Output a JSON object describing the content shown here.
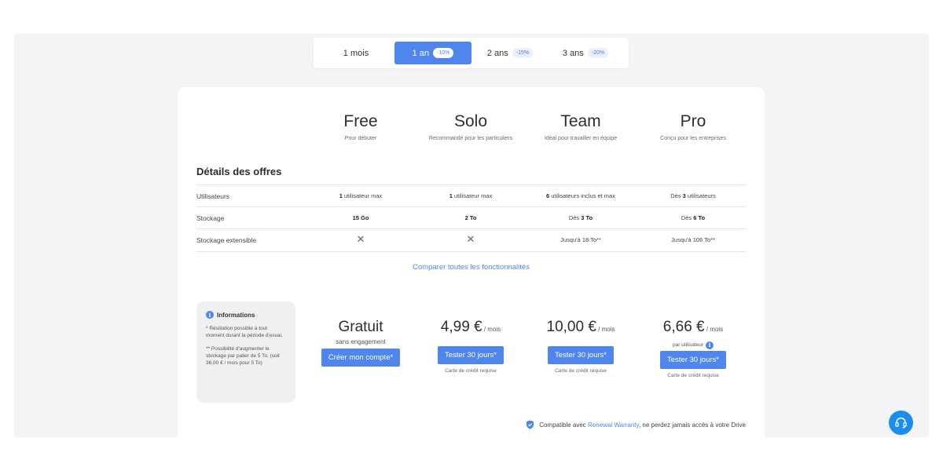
{
  "periods": [
    {
      "label": "1 mois",
      "badge": ""
    },
    {
      "label": "1 an",
      "badge": "-10%"
    },
    {
      "label": "2 ans",
      "badge": "-15%"
    },
    {
      "label": "3 ans",
      "badge": "-20%"
    }
  ],
  "active_period": "1 an",
  "plans": [
    {
      "name": "Free",
      "subtitle": "Pour débuter"
    },
    {
      "name": "Solo",
      "subtitle": "Recommandé pour les particuliers"
    },
    {
      "name": "Team",
      "subtitle": "Idéal pour travailler en équipe"
    },
    {
      "name": "Pro",
      "subtitle": "Conçu pour les entreprises"
    }
  ],
  "details_title": "Détails des offres",
  "rows": [
    {
      "label": "Utilisateurs",
      "cells": [
        {
          "bold": "1",
          "text": " utilisateur max"
        },
        {
          "bold": "1",
          "text": " utilisateur max"
        },
        {
          "bold": "6",
          "text": " utilisateurs inclus et max"
        },
        {
          "pre": "Dès ",
          "bold": "3",
          "text": " utilisateurs"
        }
      ]
    },
    {
      "label": "Stockage",
      "cells": [
        {
          "bold": "15 Go"
        },
        {
          "bold": "2 To"
        },
        {
          "pre": "Dès ",
          "bold": "3 To"
        },
        {
          "pre": "Dès ",
          "bold": "6 To"
        }
      ]
    },
    {
      "label": "Stockage extensible",
      "cells": [
        {
          "text": "✕"
        },
        {
          "text": "✕"
        },
        {
          "text": "Jusqu'à 18 To**"
        },
        {
          "text": "Jusqu'à 106 To**"
        }
      ]
    }
  ],
  "compare_link": "Comparer toutes les fonctionnalités",
  "info": {
    "title": "Informations",
    "note1": "* Résiliation possible à tout moment durant la période d'essai.",
    "note2": "** Possibilité d'augmenter le stockage par palier de 5 To. (soit 36,00 € / mois pour 5 To)"
  },
  "pricing": [
    {
      "price": "Gratuit",
      "unit": "",
      "sub": "sans engagement",
      "button": "Créer mon compte*",
      "note": ""
    },
    {
      "price": "4,99 €",
      "unit": " / mois",
      "sub": "",
      "button": "Tester 30 jours*",
      "note": "Carte de crédit requise"
    },
    {
      "price": "10,00 €",
      "unit": " / mois",
      "sub": "",
      "button": "Tester 30 jours*",
      "note": "Carte de crédit requise"
    },
    {
      "price": "6,66 €",
      "unit": " / mois",
      "sub": "par utilisateur",
      "button": "Tester 30 jours*",
      "note": "Carte de crédit requise"
    }
  ],
  "warranty": {
    "prefix": "Compatible avec ",
    "link": "Renewal Warranty",
    "suffix": ", ne perdez jamais accès à votre Drive"
  },
  "icons": {
    "info": "info-icon",
    "shield": "shield-icon",
    "support": "headset-icon",
    "cross": "cross-icon"
  },
  "colors": {
    "accent": "#4e86ee",
    "support": "#1a8df0",
    "background": "#f4f4f6"
  }
}
